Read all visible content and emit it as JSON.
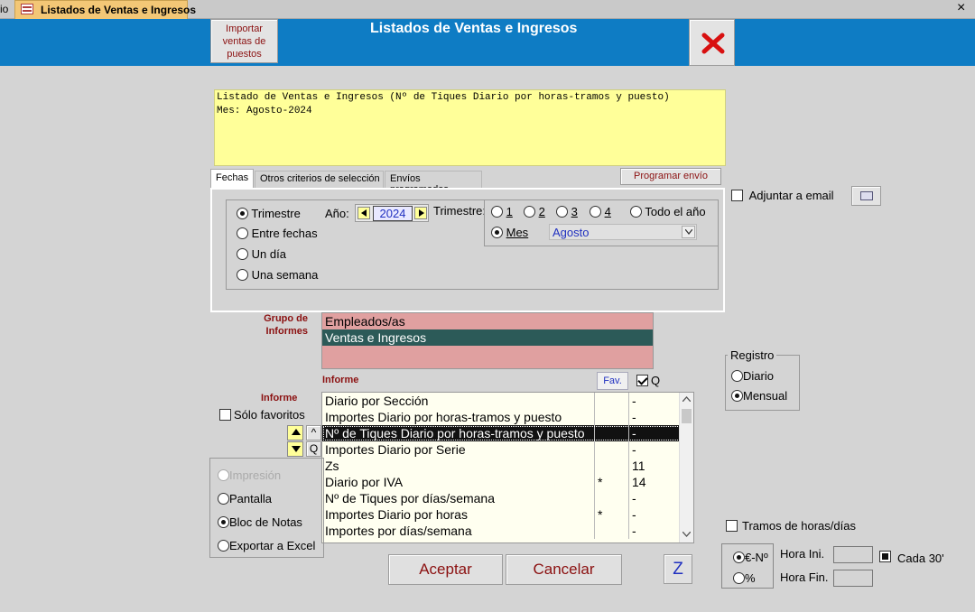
{
  "app": {
    "left_tab_fragment": "io",
    "document_tab": "Listados de Ventas e Ingresos",
    "close_glyph": "×"
  },
  "header": {
    "title": "Listados de Ventas e Ingresos",
    "import_button": "Importar ventas de puestos",
    "close_button_icon": "red-x-icon"
  },
  "preview": {
    "line1": "Listado de Ventas e Ingresos (Nº de Tiques Diario por horas-tramos y puesto)",
    "line2": "Mes: Agosto-2024"
  },
  "tabs": [
    {
      "label": "Fechas"
    },
    {
      "label": "Otros criterios de selección"
    },
    {
      "label": "Envíos programados"
    }
  ],
  "programar_envio": "Programar envío",
  "adjuntar_email": "Adjuntar a email",
  "fechas": {
    "options": [
      "Trimestre",
      "Entre fechas",
      "Un día",
      "Una semana"
    ],
    "selected": "Trimestre",
    "anio_label": "Año:",
    "anio_value": "2024",
    "trimestre_label": "Trimestre:",
    "trimestres": [
      "1",
      "2",
      "3",
      "4"
    ],
    "todo_anio": "Todo el año",
    "mes_label": "Mes",
    "mes_value": "Agosto"
  },
  "grupo": {
    "label": "Grupo de Informes",
    "items": [
      "Empleados/as",
      "Ventas e Ingresos"
    ],
    "selected": "Ventas e Ingresos"
  },
  "informe": {
    "side_label": "Informe",
    "header_label": "Informe",
    "fav_header": "Fav.",
    "q_label": "Q",
    "solo_favoritos": "Sólo favoritos",
    "sort_a": "^",
    "sort_q": "Q",
    "rows": [
      {
        "name": "Diario por Sección",
        "fav": "",
        "val": "-"
      },
      {
        "name": "Importes Diario por horas-tramos y puesto",
        "fav": "",
        "val": "-"
      },
      {
        "name": "Nº de Tiques Diario por horas-tramos y puesto",
        "fav": "",
        "val": "-"
      },
      {
        "name": "Importes Diario por Serie",
        "fav": "",
        "val": "-"
      },
      {
        "name": "Zs",
        "fav": "",
        "val": "11"
      },
      {
        "name": "Diario por IVA",
        "fav": "*",
        "val": "14"
      },
      {
        "name": "Nº de Tiques por días/semana",
        "fav": "",
        "val": "-"
      },
      {
        "name": "Importes Diario por horas",
        "fav": "*",
        "val": "-"
      },
      {
        "name": "Importes por días/semana",
        "fav": "",
        "val": "-"
      }
    ],
    "selected_index": 2
  },
  "salida": {
    "options": [
      "Impresión",
      "Pantalla",
      "Bloc de Notas",
      "Exportar a Excel"
    ],
    "selected": "Bloc de Notas",
    "disabled": "Impresión"
  },
  "registro": {
    "label": "Registro",
    "options": [
      "Diario",
      "Mensual"
    ],
    "selected": "Mensual"
  },
  "tramos": {
    "label": "Tramos de horas/días",
    "euro": "€-Nº",
    "pct": "%",
    "hora_ini": "Hora Ini.",
    "hora_fin": "Hora Fin.",
    "cada": "Cada 30'"
  },
  "buttons": {
    "aceptar": "Aceptar",
    "cancelar": "Cancelar",
    "z": "Z"
  }
}
